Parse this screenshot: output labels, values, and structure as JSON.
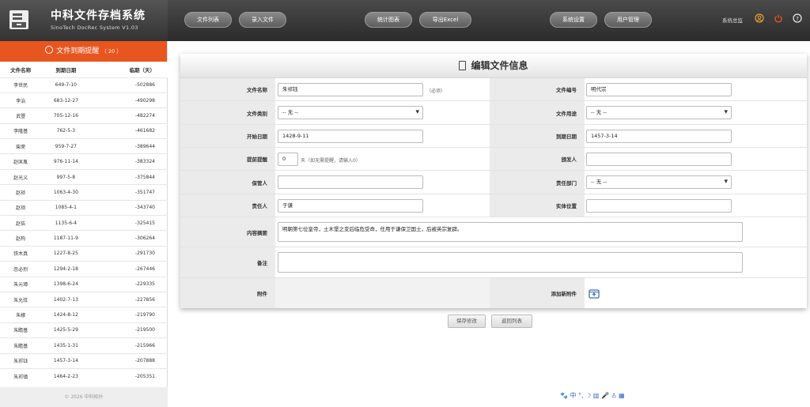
{
  "app": {
    "title": "中科文件存档系统",
    "subtitle": "SinoTech DocRec System V1.03"
  },
  "nav": [
    {
      "label": "文件列表"
    },
    {
      "label": "录入文件"
    },
    {
      "label": "统计图表"
    },
    {
      "label": "导出Excel"
    },
    {
      "label": "系统设置"
    },
    {
      "label": "用户管理"
    }
  ],
  "header_right": {
    "user_label": "系统总监",
    "icons": [
      "user-icon",
      "power-icon",
      "help-icon"
    ]
  },
  "sidebar": {
    "title": "文件到期提醒",
    "count": "（ 20 ）",
    "columns": [
      "文件名称",
      "到期日期",
      "临期（天）"
    ],
    "rows": [
      [
        "李世民",
        "649-7-10",
        "-502886"
      ],
      [
        "李治",
        "683-12-27",
        "-490298"
      ],
      [
        "武曌",
        "705-12-16",
        "-482274"
      ],
      [
        "李隆基",
        "762-5-3",
        "-461682"
      ],
      [
        "柴荣",
        "959-7-27",
        "-389644"
      ],
      [
        "赵匡胤",
        "976-11-14",
        "-383324"
      ],
      [
        "赵光义",
        "997-5-8",
        "-375844"
      ],
      [
        "赵祯",
        "1063-4-30",
        "-351747"
      ],
      [
        "赵顼",
        "1085-4-1",
        "-343740"
      ],
      [
        "赵佶",
        "1135-6-4",
        "-325415"
      ],
      [
        "赵构",
        "1187-11-9",
        "-306264"
      ],
      [
        "铁木真",
        "1227-8-25",
        "-291730"
      ],
      [
        "忽必烈",
        "1294-2-18",
        "-267446"
      ],
      [
        "朱元璋",
        "1398-6-24",
        "-229335"
      ],
      [
        "朱允炆",
        "1402-7-13",
        "-227856"
      ],
      [
        "朱棣",
        "1424-8-12",
        "-219790"
      ],
      [
        "朱瞻基",
        "1425-5-29",
        "-219500"
      ],
      [
        "朱瞻基",
        "1435-1-31",
        "-215966"
      ],
      [
        "朱祁钰",
        "1457-3-14",
        "-207888"
      ],
      [
        "朱祁镇",
        "1464-2-23",
        "-205351"
      ]
    ],
    "footer": "© 2026 中科拓扑"
  },
  "form": {
    "title": "编辑文件信息",
    "name_label": "文件名称",
    "name_value": "朱祁钰",
    "name_hint": "（必须）",
    "code_label": "文件编号",
    "code_value": "明代宗",
    "category_label": "文件类别",
    "category_value": "-- 无 --",
    "usage_label": "文件用途",
    "usage_value": "-- 无 --",
    "start_label": "开始日期",
    "start_value": "1428-9-11",
    "due_label": "到期日期",
    "due_value": "1457-3-14",
    "remind_label": "提前提醒",
    "remind_value": "0",
    "remind_hint": "天（如无需提醒，请输入0）",
    "issuer_label": "颁发人",
    "issuer_value": "",
    "keeper_label": "保管人",
    "keeper_value": "",
    "dept_label": "责任部门",
    "dept_value": "-- 无 --",
    "owner_label": "责任人",
    "owner_value": "于谦",
    "location_label": "实体位置",
    "location_value": "",
    "summary_label": "内容摘要",
    "summary_value": "明朝第七位皇帝，土木堡之变后临危受命，任用于谦保卫国土，后被英宗复辟。",
    "note_label": "备注",
    "note_value": "",
    "attach_label": "附件",
    "add_attach_label": "添加新附件"
  },
  "buttons": {
    "save": "保存修改",
    "back": "返回列表"
  },
  "ime_bar": "🐾 中 °, ☽ ▥ 🎤 ♙ ▦"
}
